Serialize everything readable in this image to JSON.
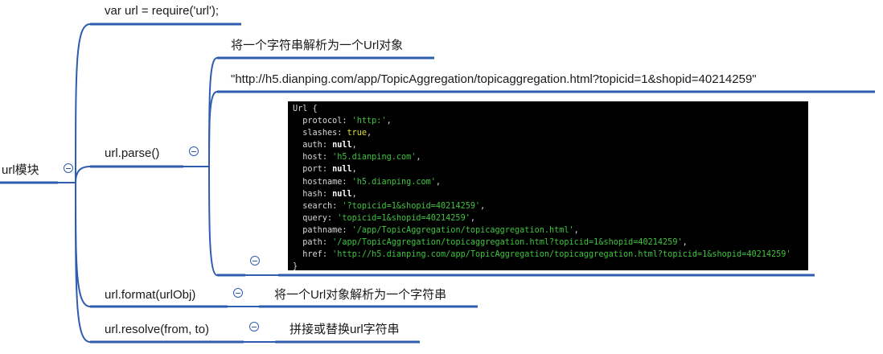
{
  "root": {
    "label": "url模块"
  },
  "branches": {
    "require": {
      "label": "var url = require('url');"
    },
    "parse": {
      "label": "url.parse()",
      "description": "将一个字符串解析为一个Url对象",
      "example_input": "\"http://h5.dianping.com/app/TopicAggregation/topicaggregation.html?topicid=1&shopid=40214259\"",
      "output": {
        "header": "Url {",
        "lines": [
          {
            "key": "protocol",
            "value": "'http:'",
            "type": "string"
          },
          {
            "key": "slashes",
            "value": "true",
            "type": "bool"
          },
          {
            "key": "auth",
            "value": "null",
            "type": "null"
          },
          {
            "key": "host",
            "value": "'h5.dianping.com'",
            "type": "string"
          },
          {
            "key": "port",
            "value": "null",
            "type": "null"
          },
          {
            "key": "hostname",
            "value": "'h5.dianping.com'",
            "type": "string"
          },
          {
            "key": "hash",
            "value": "null",
            "type": "null"
          },
          {
            "key": "search",
            "value": "'?topicid=1&shopid=40214259'",
            "type": "string"
          },
          {
            "key": "query",
            "value": "'topicid=1&shopid=40214259'",
            "type": "string"
          },
          {
            "key": "pathname",
            "value": "'/app/TopicAggregation/topicaggregation.html'",
            "type": "string"
          },
          {
            "key": "path",
            "value": "'/app/TopicAggregation/topicaggregation.html?topicid=1&shopid=40214259'",
            "type": "string"
          },
          {
            "key": "href",
            "value": "'http://h5.dianping.com/app/TopicAggregation/topicaggregation.html?topicid=1&shopid=40214259'",
            "type": "string"
          }
        ],
        "footer": "}"
      }
    },
    "format": {
      "label": "url.format(urlObj)",
      "description": "将一个Url对象解析为一个字符串"
    },
    "resolve": {
      "label": "url.resolve(from, to)",
      "description": "拼接或替换url字符串"
    }
  },
  "colors": {
    "line": "#2e5cae",
    "node_underline": "#2e5cae",
    "code_bg": "#000000",
    "code_string": "#3ec43e",
    "code_bool": "#e3df3a"
  }
}
